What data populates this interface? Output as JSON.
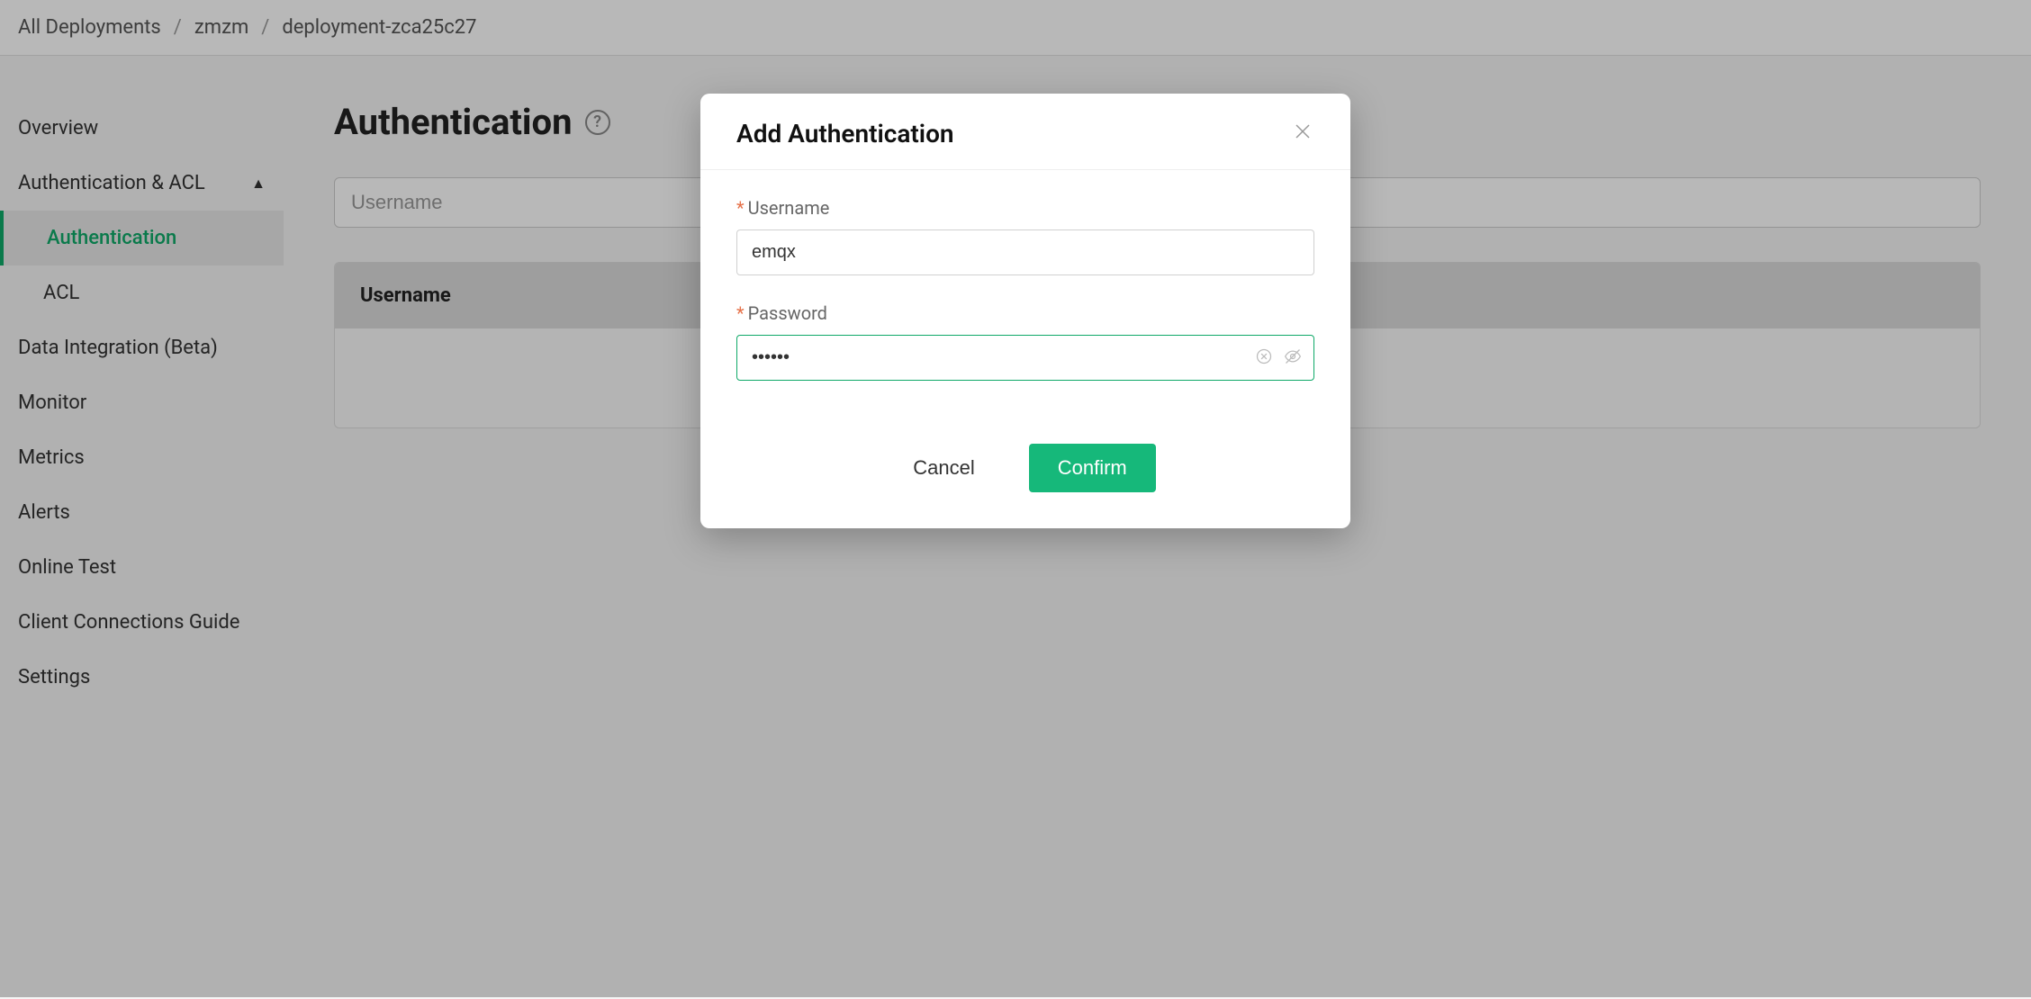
{
  "breadcrumb": {
    "items": [
      "All Deployments",
      "zmzm",
      "deployment-zca25c27"
    ]
  },
  "sidebar": {
    "overview": "Overview",
    "auth_acl": "Authentication & ACL",
    "authentication": "Authentication",
    "acl": "ACL",
    "data_integration": "Data Integration (Beta)",
    "monitor": "Monitor",
    "metrics": "Metrics",
    "alerts": "Alerts",
    "online_test": "Online Test",
    "client_connections": "Client Connections Guide",
    "settings": "Settings"
  },
  "page": {
    "title": "Authentication",
    "search_placeholder": "Username",
    "table_header": "Username"
  },
  "modal": {
    "title": "Add Authentication",
    "username_label": "Username",
    "username_value": "emqx",
    "password_label": "Password",
    "password_value": "••••••",
    "cancel": "Cancel",
    "confirm": "Confirm"
  }
}
